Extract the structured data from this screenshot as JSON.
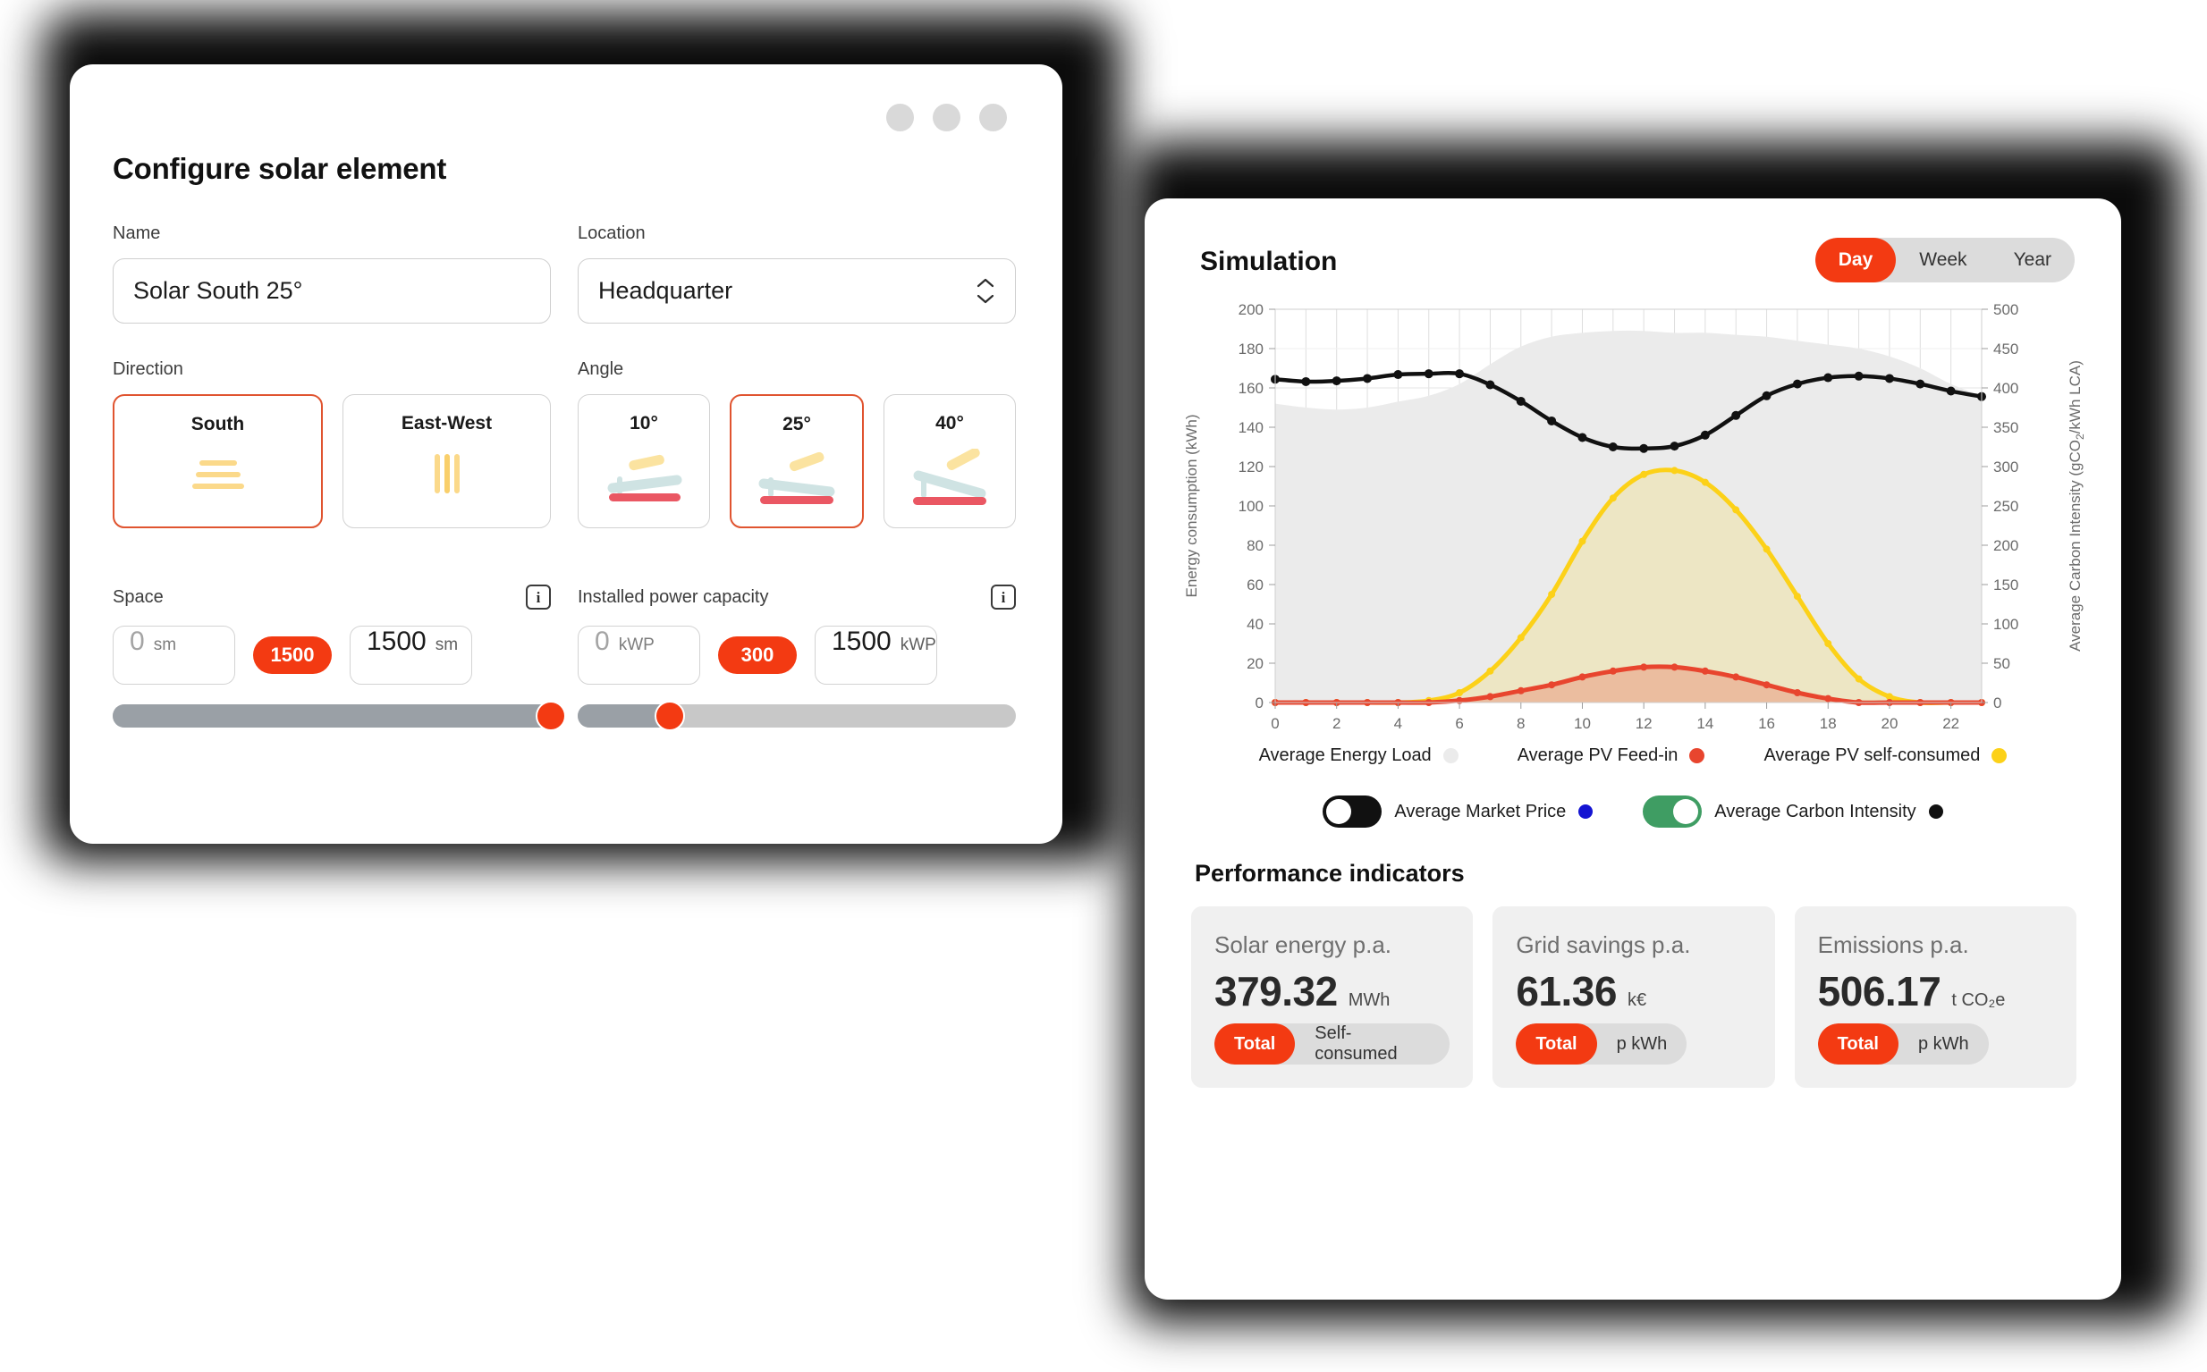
{
  "colors": {
    "accent": "#f33a12",
    "selected_border": "#e05430",
    "toggle_on": "#3f9d63",
    "toggle_off": "#111111",
    "load_area": "#ebebeb",
    "feedin": "#e8452e",
    "selfconsumed": "#fcd118",
    "carbon": "#111111",
    "market_price": "#1414d2"
  },
  "left_panel": {
    "title": "Configure solar element",
    "window_dots": [
      "dot",
      "dot",
      "dot"
    ],
    "name": {
      "label": "Name",
      "value": "Solar South 25°"
    },
    "location": {
      "label": "Location",
      "value": "Headquarter"
    },
    "direction": {
      "label": "Direction",
      "options": [
        {
          "label": "South",
          "selected": true,
          "icon": "horizontal-lines-icon"
        },
        {
          "label": "East-West",
          "selected": false,
          "icon": "vertical-lines-icon"
        }
      ]
    },
    "angle": {
      "label": "Angle",
      "options": [
        {
          "label": "10°",
          "selected": false,
          "icon": "panel-tilt-10-icon"
        },
        {
          "label": "25°",
          "selected": true,
          "icon": "panel-tilt-25-icon"
        },
        {
          "label": "40°",
          "selected": false,
          "icon": "panel-tilt-40-icon"
        }
      ]
    },
    "space": {
      "label": "Space",
      "info": "i",
      "min_value": "0",
      "min_unit": "sm",
      "badge": "1500",
      "max_value": "1500",
      "max_unit": "sm",
      "slider_percent": 100
    },
    "capacity": {
      "label": "Installed power capacity",
      "info": "i",
      "min_value": "0",
      "min_unit": "kWP",
      "badge": "300",
      "max_value": "1500",
      "max_unit": "kWP",
      "slider_percent": 21
    }
  },
  "right_panel": {
    "title": "Simulation",
    "window_dots": [
      "dot",
      "dot",
      "dot"
    ],
    "range_tabs": [
      {
        "label": "Day",
        "active": true
      },
      {
        "label": "Week",
        "active": false
      },
      {
        "label": "Year",
        "active": false
      }
    ],
    "legend": [
      {
        "label": "Average Energy Load",
        "color": "#ebebeb"
      },
      {
        "label": "Average PV Feed-in",
        "color": "#e8452e"
      },
      {
        "label": "Average PV self-consumed",
        "color": "#fcd118"
      }
    ],
    "toggles": [
      {
        "label": "Average Market Price",
        "color": "#1414d2",
        "on": false
      },
      {
        "label": "Average Carbon Intensity",
        "color": "#111111",
        "on": true
      }
    ],
    "performance": {
      "title": "Performance indicators",
      "cards": [
        {
          "label": "Solar energy p.a.",
          "value": "379.32",
          "unit": "MWh",
          "segments": [
            {
              "label": "Total",
              "active": true
            },
            {
              "label": "Self-consumed",
              "active": false
            }
          ]
        },
        {
          "label": "Grid savings p.a.",
          "value": "61.36",
          "unit": "k€",
          "segments": [
            {
              "label": "Total",
              "active": true
            },
            {
              "label": "p kWh",
              "active": false
            }
          ]
        },
        {
          "label": "Emissions p.a.",
          "value": "506.17",
          "unit": "t CO₂e",
          "segments": [
            {
              "label": "Total",
              "active": true
            },
            {
              "label": "p kWh",
              "active": false
            }
          ]
        }
      ]
    }
  },
  "chart_data": {
    "type": "area",
    "title": "",
    "xlabel": "",
    "ylabel": "Energy consumption (kWh)",
    "y2label": "Average Carbon Intensity (gCO₂/kWh LCA)",
    "grid": true,
    "legend_position": "bottom",
    "x": [
      0,
      1,
      2,
      3,
      4,
      5,
      6,
      7,
      8,
      9,
      10,
      11,
      12,
      13,
      14,
      15,
      16,
      17,
      18,
      19,
      20,
      21,
      22,
      23
    ],
    "xtick_labels": [
      "0",
      "2",
      "4",
      "6",
      "8",
      "10",
      "12",
      "14",
      "16",
      "18",
      "20",
      "22"
    ],
    "ylim": [
      0,
      200
    ],
    "ytick_labels": [
      "0",
      "20",
      "40",
      "60",
      "80",
      "100",
      "120",
      "140",
      "160",
      "180",
      "200"
    ],
    "y2lim": [
      0,
      500
    ],
    "y2tick_labels": [
      "0",
      "50",
      "100",
      "150",
      "200",
      "250",
      "300",
      "350",
      "400",
      "450",
      "500"
    ],
    "series": [
      {
        "name": "Average Energy Load",
        "color": "#ebebeb",
        "kind": "area",
        "axis": "left",
        "values": [
          152,
          150,
          149,
          150,
          153,
          156,
          162,
          172,
          181,
          186,
          188,
          189,
          189,
          188,
          188,
          187,
          186,
          184,
          182,
          180,
          176,
          170,
          162,
          156
        ]
      },
      {
        "name": "Average PV self-consumed",
        "color": "#fcd118",
        "kind": "area-line",
        "axis": "left",
        "values": [
          0,
          0,
          0,
          0,
          0,
          1,
          5,
          16,
          33,
          55,
          82,
          104,
          116,
          118,
          112,
          98,
          78,
          54,
          30,
          12,
          3,
          0,
          0,
          0
        ]
      },
      {
        "name": "Average PV Feed-in",
        "color": "#e8452e",
        "kind": "area-line",
        "axis": "left",
        "values": [
          0,
          0,
          0,
          0,
          0,
          0,
          1,
          3,
          6,
          9,
          13,
          16,
          18,
          18,
          16,
          13,
          9,
          5,
          2,
          0,
          0,
          0,
          0,
          0
        ]
      },
      {
        "name": "Average Carbon Intensity",
        "color": "#111111",
        "kind": "line",
        "axis": "right",
        "values": [
          411,
          408,
          409,
          412,
          417,
          418,
          418,
          404,
          383,
          358,
          337,
          325,
          323,
          326,
          340,
          365,
          390,
          405,
          413,
          415,
          412,
          405,
          396,
          389
        ]
      }
    ]
  }
}
